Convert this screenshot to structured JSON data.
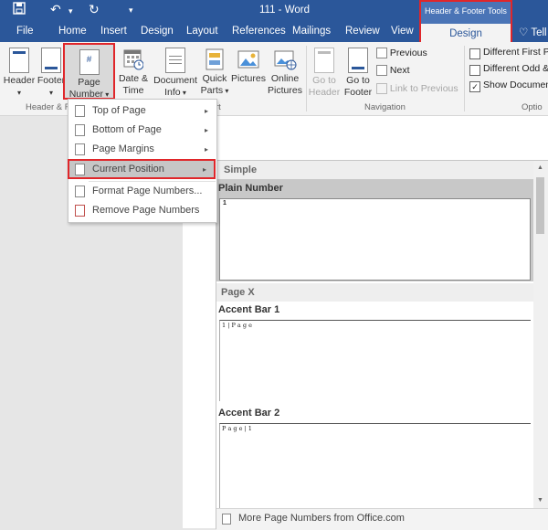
{
  "window": {
    "title": "111 - Word"
  },
  "tabs": [
    "File",
    "Home",
    "Insert",
    "Design",
    "Layout",
    "References",
    "Mailings",
    "Review",
    "View"
  ],
  "contextual": {
    "group_label": "Header & Footer Tools",
    "tab": "Design",
    "tell": "Tell"
  },
  "ribbon": {
    "header": "Header",
    "footer": "Footer",
    "page_number": [
      "Page",
      "Number"
    ],
    "date_time": [
      "Date &",
      "Time"
    ],
    "document_info": [
      "Document",
      "Info"
    ],
    "quick_parts": [
      "Quick",
      "Parts"
    ],
    "pictures": "Pictures",
    "online_pictures": [
      "Online",
      "Pictures"
    ],
    "go_to_header": [
      "Go to",
      "Header"
    ],
    "go_to_footer": [
      "Go to",
      "Footer"
    ],
    "previous": "Previous",
    "next": "Next",
    "link_to_previous": "Link to Previous",
    "opt_first": "Different First P",
    "opt_odd_even": "Different Odd &",
    "opt_show_doc": "Show Documen",
    "group_hf": "Header & F",
    "group_insert_tail": "rt",
    "group_navigation": "Navigation",
    "group_options": "Optio"
  },
  "menu": {
    "items": [
      {
        "label": "Top of Page",
        "submenu": true
      },
      {
        "label": "Bottom of Page",
        "submenu": true
      },
      {
        "label": "Page Margins",
        "submenu": true
      },
      {
        "label": "Current Position",
        "submenu": true
      },
      {
        "label": "Format Page Numbers...",
        "submenu": false
      },
      {
        "label": "Remove Page Numbers",
        "submenu": false
      }
    ]
  },
  "gallery": {
    "section_simple": "Simple",
    "plain_number": "Plain Number",
    "section_page_x": "Page X",
    "accent_bar_1": "Accent Bar 1",
    "accent_bar_1_preview": "1 | P a g e",
    "accent_bar_2": "Accent Bar 2",
    "accent_bar_2_preview": "P a g e | 1",
    "plain_number_preview": "1",
    "more": "More Page Numbers from Office.com"
  },
  "colors": {
    "accent": "#2b579a",
    "highlight": "#e0262a"
  }
}
